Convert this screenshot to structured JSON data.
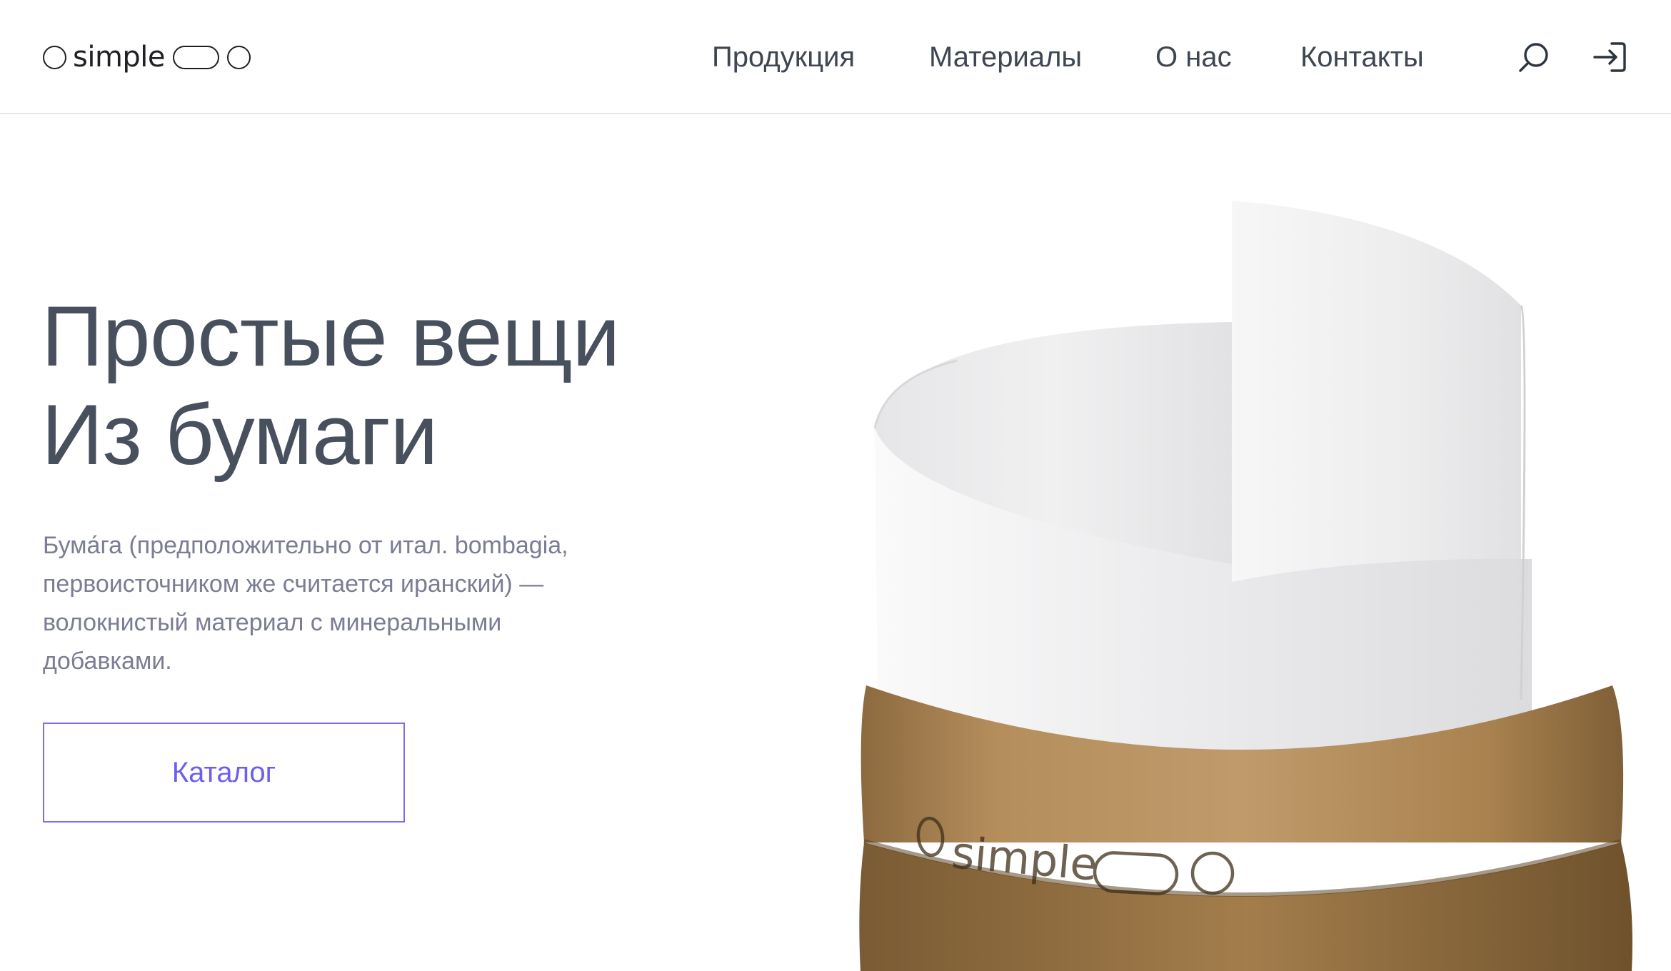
{
  "brand": {
    "logo_text": "simple",
    "accent_color": "#6b5ff0",
    "text_color": "#48505e"
  },
  "header": {
    "nav": [
      {
        "label": "Продукция"
      },
      {
        "label": "Материалы"
      },
      {
        "label": "О нас"
      },
      {
        "label": "Контакты"
      }
    ],
    "icons": [
      "search-icon",
      "login-icon"
    ]
  },
  "hero": {
    "title_line1": "Простые вещи",
    "title_line2": "Из бумаги",
    "description": "Бума́га (предположительно от итал. bombagia, первоисточником же считается иранский) — волокнистый материал с минеральными добавками.",
    "cta_label": "Каталог"
  },
  "product_image": {
    "label_text": "simple",
    "colors": {
      "paper": "#f3f3f4",
      "kraft": "#b08a5a"
    }
  }
}
